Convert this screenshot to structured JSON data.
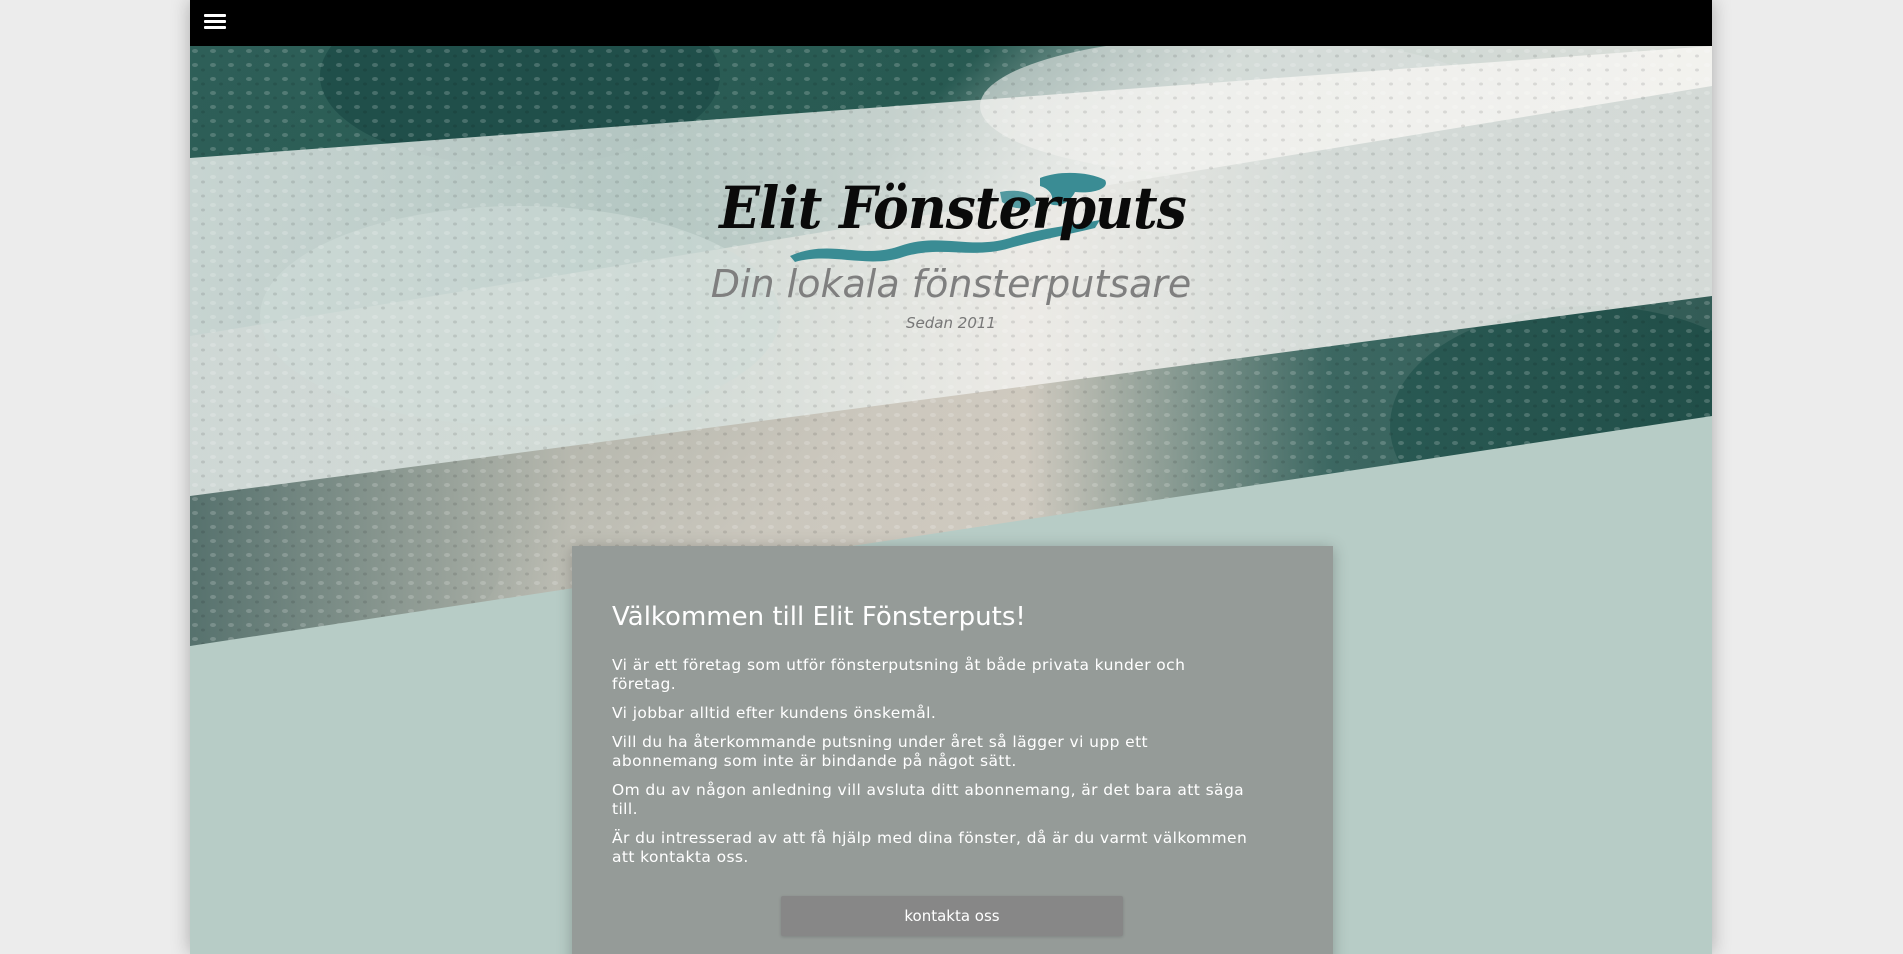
{
  "header": {
    "menu_icon": "hamburger-menu-icon"
  },
  "hero": {
    "logo_text": "Elit Fönsterputs",
    "tagline": "Din lokala fönsterputsare",
    "since": "Sedan 2011"
  },
  "welcome": {
    "title": "Välkommen till Elit Fönsterputs!",
    "paragraphs": [
      "Vi är ett företag som utför fönsterputsning åt både privata kunder och företag.",
      "Vi jobbar alltid efter kundens önskemål.",
      "Vill du ha återkommande putsning under året så lägger vi upp ett abonnemang som inte är bindande på något sätt.",
      "Om du av någon anledning vill avsluta ditt abonnemang, är det bara att säga till.",
      "Är du intresserad av att få hjälp med dina fönster, då är du varmt välkommen att kontakta oss."
    ],
    "contact_button": "kontakta oss"
  },
  "colors": {
    "topbar": "#000000",
    "page_background": "#b7ccc6",
    "card_background": "#959b98",
    "button_background": "#878787",
    "logo_accent": "#3a8c94"
  }
}
